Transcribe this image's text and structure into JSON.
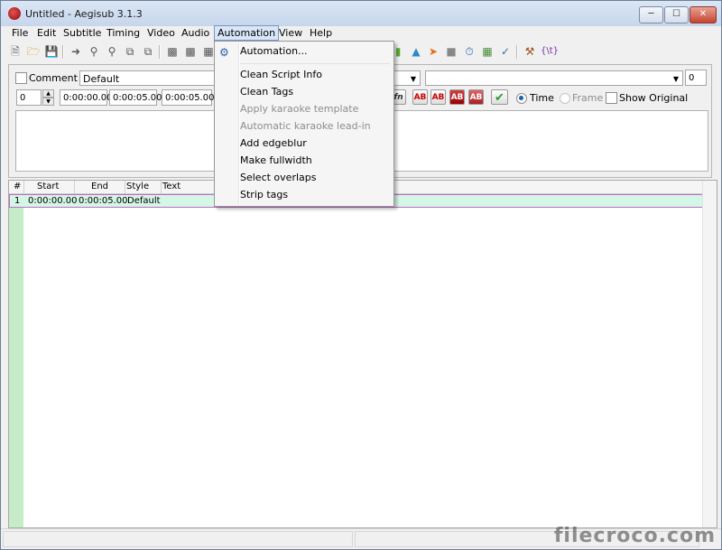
{
  "window": {
    "title": "Untitled - Aegisub 3.1.3"
  },
  "menubar": {
    "items": [
      "File",
      "Edit",
      "Subtitle",
      "Timing",
      "Video",
      "Audio",
      "Automation",
      "View",
      "Help"
    ]
  },
  "edit": {
    "comment_label": "Comment",
    "style_value": "Default",
    "layer_value": "0",
    "start_value": "0:00:00.00",
    "end_value": "0:00:05.00",
    "duration_value": "0:00:05.00",
    "margin_value": "0",
    "fn_label": "fn",
    "ab_labels": [
      "AB",
      "AB",
      "AB",
      "AB"
    ],
    "time_label": "Time",
    "frame_label": "Frame",
    "show_original_label": "Show Original"
  },
  "grid": {
    "headers": [
      "#",
      "Start",
      "End",
      "Style",
      "Text"
    ],
    "row": {
      "num": "1",
      "start": "0:00:00.00",
      "end": "0:00:05.00",
      "style": "Default",
      "text": ""
    }
  },
  "automation_menu": {
    "items": [
      {
        "label": "Automation...",
        "enabled": true
      },
      {
        "label": "Clean Script Info",
        "enabled": true
      },
      {
        "label": "Clean Tags",
        "enabled": true
      },
      {
        "label": "Apply karaoke template",
        "enabled": false
      },
      {
        "label": "Automatic karaoke lead-in",
        "enabled": false
      },
      {
        "label": "Add edgeblur",
        "enabled": true
      },
      {
        "label": "Make fullwidth",
        "enabled": true
      },
      {
        "label": "Select overlaps",
        "enabled": true
      },
      {
        "label": "Strip tags",
        "enabled": true
      }
    ]
  },
  "watermark": "filecroco.com",
  "colors": {
    "accent_highlight": "#d9e6f8",
    "row_bg": "#d4f6e6",
    "gutter": "#c5ecc7",
    "row_border": "#c36bc3"
  }
}
